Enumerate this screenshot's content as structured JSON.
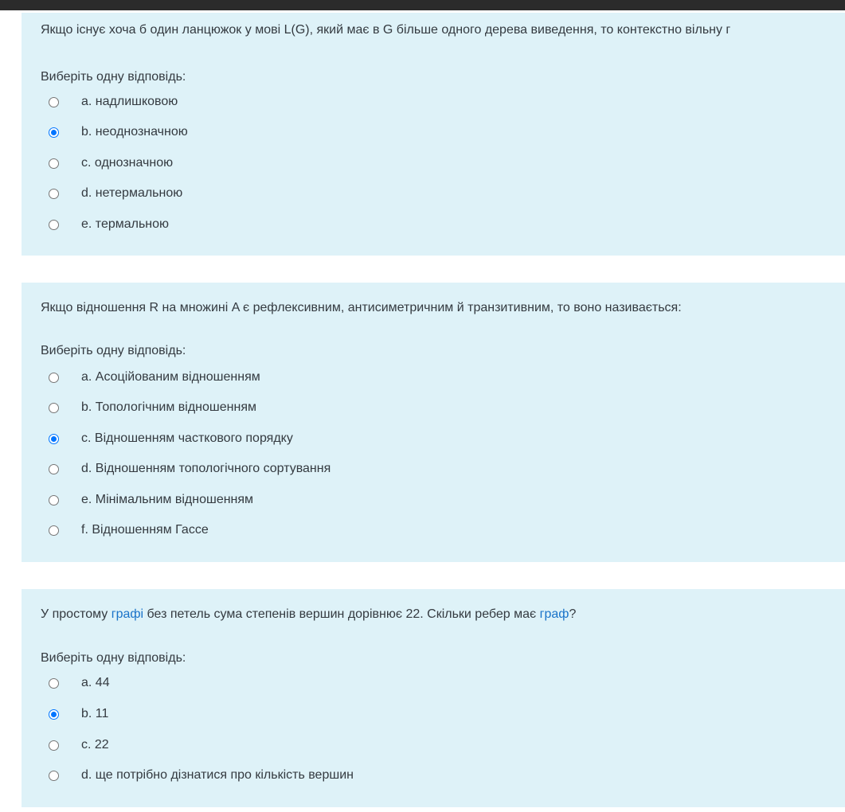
{
  "questions": [
    {
      "text": "Якщо існує хоча б один ланцюжок у мові L(G), який має в G більше одного дерева виведення, то контекстно вільну г",
      "prompt": "Виберіть одну відповідь:",
      "options": [
        {
          "label": "a. надлишковою",
          "checked": false
        },
        {
          "label": "b. неоднозначною",
          "checked": true
        },
        {
          "label": "c. однозначною",
          "checked": false
        },
        {
          "label": "d. нетермальною",
          "checked": false
        },
        {
          "label": "e. термальною",
          "checked": false
        }
      ]
    },
    {
      "text": "Якщо відношення R на множині A є рефлексивним, антисиметричним й транзитивним, то воно називається:",
      "prompt": "Виберіть одну відповідь:",
      "options": [
        {
          "label": "a. Асоційованим відношенням",
          "checked": false
        },
        {
          "label": "b. Топологічним відношенням",
          "checked": false
        },
        {
          "label": "c. Відношенням часткового порядку",
          "checked": true
        },
        {
          "label": "d. Відношенням топологічного сортування",
          "checked": false
        },
        {
          "label": "e. Мінімальним відношенням",
          "checked": false
        },
        {
          "label": "f. Відношенням Гассе",
          "checked": false
        }
      ]
    },
    {
      "text_parts": [
        "У простому ",
        "графі",
        " без петель сума степенів вершин дорівнює 22. Скільки ребер має ",
        "граф",
        "?"
      ],
      "prompt": "Виберіть одну відповідь:",
      "options": [
        {
          "label": "a. 44",
          "checked": false
        },
        {
          "label": "b. 11",
          "checked": true
        },
        {
          "label": "c. 22",
          "checked": false
        },
        {
          "label": "d. ще потрібно дізнатися про кількість вершин",
          "checked": false
        }
      ]
    }
  ],
  "colors": {
    "card_bg": "#def2f8",
    "link": "#1a73c9",
    "radio_checked": "#0075ff"
  }
}
